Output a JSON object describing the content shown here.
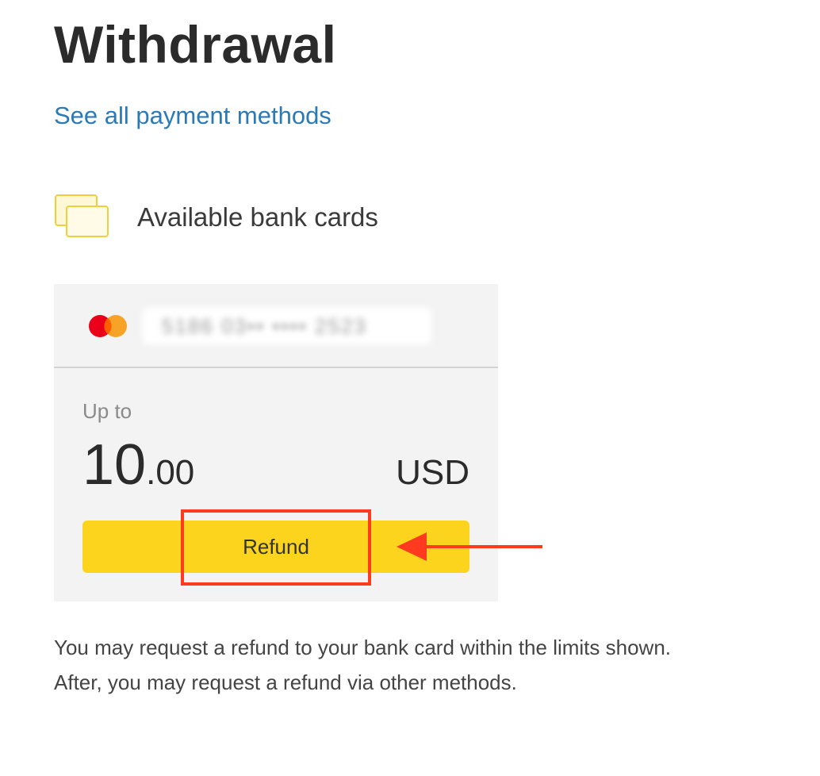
{
  "page": {
    "title": "Withdrawal",
    "payment_methods_link": "See all payment methods"
  },
  "cards_section": {
    "heading": "Available bank cards",
    "icon": "cards-icon"
  },
  "card": {
    "brand_icon": "mastercard-icon",
    "number_masked": "5186 03•• •••• 2523",
    "limit_label": "Up to",
    "amount_int": "10",
    "amount_dec": ".00",
    "currency": "USD",
    "refund_label": "Refund"
  },
  "note": {
    "line1": "You may request a refund to your bank card within the limits shown.",
    "line2": "After, you may request a refund via other methods."
  },
  "colors": {
    "accent_yellow": "#fcd31d",
    "link_blue": "#2a7ab8",
    "highlight_red": "#ff3a1f",
    "mastercard_red": "#eb001b",
    "mastercard_orange": "#f79e1b"
  }
}
